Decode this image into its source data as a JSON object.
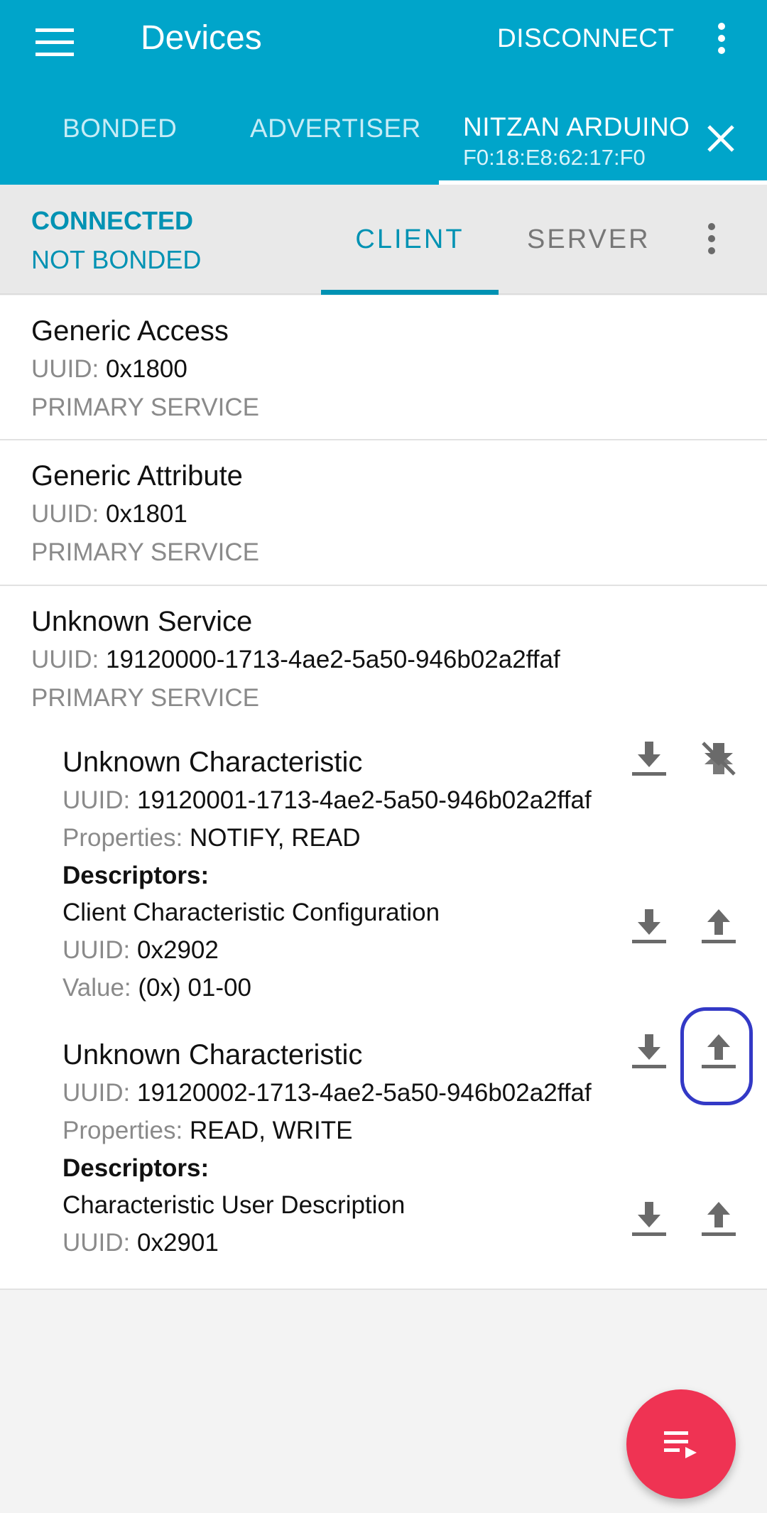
{
  "appbar": {
    "title": "Devices",
    "disconnect_label": "DISCONNECT",
    "tabs": [
      {
        "label": "BONDED"
      },
      {
        "label": "ADVERTISER"
      }
    ],
    "device_tab": {
      "name": "NITZAN ARDUINO",
      "address": "F0:18:E8:62:17:F0"
    }
  },
  "subbar": {
    "connection_status": "CONNECTED",
    "bond_status": "NOT BONDED",
    "tabs": [
      {
        "label": "CLIENT"
      },
      {
        "label": "SERVER"
      }
    ]
  },
  "labels": {
    "uuid": "UUID:",
    "properties": "Properties:",
    "descriptors": "Descriptors:",
    "value": "Value:"
  },
  "services": [
    {
      "name": "Generic Access",
      "uuid": "0x1800",
      "type": "PRIMARY SERVICE"
    },
    {
      "name": "Generic Attribute",
      "uuid": "0x1801",
      "type": "PRIMARY SERVICE"
    },
    {
      "name": "Unknown Service",
      "uuid": "19120000-1713-4ae2-5a50-946b02a2ffaf",
      "type": "PRIMARY SERVICE",
      "characteristics": [
        {
          "name": "Unknown Characteristic",
          "uuid": "19120001-1713-4ae2-5a50-946b02a2ffaf",
          "properties": "NOTIFY, READ",
          "descriptor": {
            "name": "Client Characteristic Configuration",
            "uuid": "0x2902",
            "value": "(0x) 01-00"
          }
        },
        {
          "name": "Unknown Characteristic",
          "uuid": "19120002-1713-4ae2-5a50-946b02a2ffaf",
          "properties": "READ, WRITE",
          "descriptor": {
            "name": "Characteristic User Description",
            "uuid": "0x2901"
          }
        }
      ]
    }
  ],
  "colors": {
    "primary": "#00a5ca",
    "accent": "#0092b3",
    "fab": "#ef3353",
    "highlight": "#3339c6"
  }
}
